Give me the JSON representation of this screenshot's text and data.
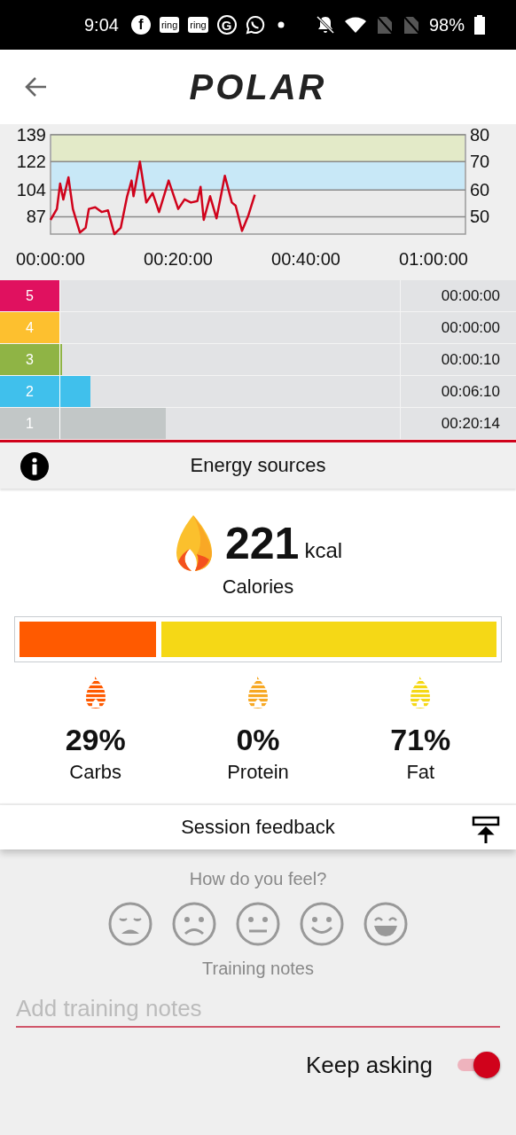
{
  "status_bar": {
    "time": "9:04",
    "notifications": [
      {
        "kind": "badge-circle",
        "text": "f"
      },
      {
        "kind": "badge-square",
        "text": "ring"
      },
      {
        "kind": "badge-square",
        "text": "ring"
      },
      {
        "kind": "badge-ring",
        "text": "G"
      },
      {
        "kind": "chat"
      },
      {
        "kind": "dot"
      }
    ],
    "battery": "98%"
  },
  "header": {
    "logo": "POLAR"
  },
  "hr_chart": {
    "right_axis_ticks": [
      "80",
      "70",
      "60",
      "50"
    ],
    "chart_data": {
      "type": "line",
      "x": [
        0,
        1,
        1.5,
        2,
        2.8,
        3.5,
        4.6,
        5.5,
        6,
        7,
        8,
        9,
        10,
        11,
        12,
        12.7,
        13,
        14,
        15,
        16,
        17,
        18.5,
        20,
        21,
        22,
        23,
        23.5,
        24,
        25,
        26,
        27.3,
        28.4,
        29,
        30,
        31,
        32
      ],
      "grid": true,
      "bands": [
        {
          "axis": "y",
          "from": 122,
          "to": 139,
          "color": "#e3eac8"
        },
        {
          "axis": "y",
          "from": 104,
          "to": 122,
          "color": "#c8e8f7"
        }
      ],
      "series": [
        {
          "color": "#d0021b",
          "values": [
            85,
            92,
            108,
            98,
            112,
            92,
            77,
            80,
            92,
            93,
            90,
            91,
            76,
            80,
            100,
            110,
            100,
            122,
            96,
            102,
            90,
            110,
            92,
            98,
            96,
            97,
            106,
            85,
            100,
            86,
            113,
            96,
            94,
            78,
            88,
            101
          ]
        }
      ],
      "xlim": [
        0,
        65
      ],
      "ylim": [
        76,
        139
      ],
      "xticks": [
        {
          "value": 0,
          "label": "00:00:00"
        },
        {
          "value": 20,
          "label": "00:20:00"
        },
        {
          "value": 40,
          "label": "00:40:00"
        },
        {
          "value": 60,
          "label": "01:00:00"
        }
      ],
      "yticks": [
        87,
        104,
        122,
        139
      ]
    }
  },
  "zones": [
    {
      "label": "5",
      "color": "#e0115f",
      "time": "00:00:00"
    },
    {
      "label": "4",
      "color": "#fdc02f",
      "time": "00:00:00"
    },
    {
      "label": "3",
      "color": "#8fb445",
      "level": 0.004,
      "time": "00:00:10"
    },
    {
      "label": "2",
      "color": "#40c0ec",
      "level": 0.09,
      "time": "00:06:10"
    },
    {
      "label": "1",
      "color": "#c2c7c7",
      "level": 0.31,
      "time": "00:20:14"
    }
  ],
  "energy": {
    "title": "Energy sources",
    "calories": "221",
    "unit": "kcal",
    "calories_label": "Calories",
    "macros": [
      {
        "percent": "29%",
        "label": "Carbs",
        "color": "#ff5a00"
      },
      {
        "percent": "0%",
        "label": "Protein",
        "color": "#f7a823"
      },
      {
        "percent": "71%",
        "label": "Fat",
        "color": "#f5d816"
      }
    ]
  },
  "feedback": {
    "title": "Session feedback",
    "question": "How do you feel?",
    "moods": [
      {
        "kind": "very-sad",
        "selected": false
      },
      {
        "kind": "sad",
        "selected": false
      },
      {
        "kind": "neutral",
        "selected": false
      },
      {
        "kind": "happy",
        "selected": false
      },
      {
        "kind": "very-happy",
        "selected": false
      }
    ],
    "notes_label": "Training notes",
    "notes": {
      "placeholder": "Add training notes"
    },
    "keep_asking": {
      "label": "Keep asking",
      "on": true
    }
  }
}
